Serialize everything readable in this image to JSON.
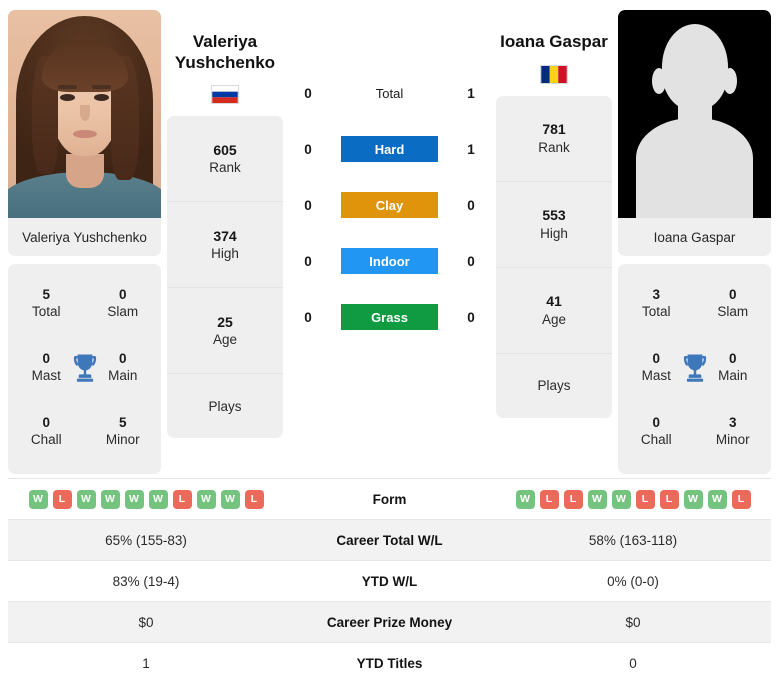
{
  "players": {
    "left": {
      "name": "Valeriya Yushchenko",
      "name_line1": "Valeriya",
      "name_line2": "Yushchenko",
      "photo_caption": "Valeriya Yushchenko",
      "country": "Russia",
      "flag_icon": "flag-russia",
      "attributes": [
        {
          "value": "605",
          "label": "Rank"
        },
        {
          "value": "374",
          "label": "High"
        },
        {
          "value": "25",
          "label": "Age"
        },
        {
          "value": "",
          "label": "Plays"
        }
      ],
      "titles": [
        {
          "value": "5",
          "label": "Total"
        },
        {
          "value": "0",
          "label": "Slam"
        },
        {
          "value": "0",
          "label": "Mast"
        },
        {
          "value": "0",
          "label": "Main"
        },
        {
          "value": "0",
          "label": "Chall"
        },
        {
          "value": "5",
          "label": "Minor"
        }
      ],
      "form": [
        "W",
        "L",
        "W",
        "W",
        "W",
        "W",
        "L",
        "W",
        "W",
        "L"
      ]
    },
    "right": {
      "name": "Ioana Gaspar",
      "name_line1": "Ioana Gaspar",
      "name_line2": "",
      "photo_caption": "Ioana Gaspar",
      "country": "Romania",
      "flag_icon": "flag-romania",
      "attributes": [
        {
          "value": "781",
          "label": "Rank"
        },
        {
          "value": "553",
          "label": "High"
        },
        {
          "value": "41",
          "label": "Age"
        },
        {
          "value": "",
          "label": "Plays"
        }
      ],
      "titles": [
        {
          "value": "3",
          "label": "Total"
        },
        {
          "value": "0",
          "label": "Slam"
        },
        {
          "value": "0",
          "label": "Mast"
        },
        {
          "value": "0",
          "label": "Main"
        },
        {
          "value": "0",
          "label": "Chall"
        },
        {
          "value": "3",
          "label": "Minor"
        }
      ],
      "form": [
        "W",
        "L",
        "L",
        "W",
        "W",
        "L",
        "L",
        "W",
        "W",
        "L"
      ]
    }
  },
  "head_to_head": [
    {
      "label": "Total",
      "left": "0",
      "right": "1",
      "color": "",
      "style": "plain"
    },
    {
      "label": "Hard",
      "left": "0",
      "right": "1",
      "color": "#0b6cc4",
      "style": "bar"
    },
    {
      "label": "Clay",
      "left": "0",
      "right": "0",
      "color": "#e0940b",
      "style": "bar"
    },
    {
      "label": "Indoor",
      "left": "0",
      "right": "0",
      "color": "#2196f3",
      "style": "bar"
    },
    {
      "label": "Grass",
      "left": "0",
      "right": "0",
      "color": "#109b43",
      "style": "bar"
    }
  ],
  "comparison_rows": [
    {
      "label": "Form",
      "left": "",
      "right": "",
      "type": "form",
      "shaded": false
    },
    {
      "label": "Career Total W/L",
      "left": "65% (155-83)",
      "right": "58% (163-118)",
      "type": "text",
      "shaded": true
    },
    {
      "label": "YTD W/L",
      "left": "83% (19-4)",
      "right": "0% (0-0)",
      "type": "text",
      "shaded": false
    },
    {
      "label": "Career Prize Money",
      "left": "$0",
      "right": "$0",
      "type": "text",
      "shaded": true
    },
    {
      "label": "YTD Titles",
      "left": "1",
      "right": "0",
      "type": "text",
      "shaded": false
    }
  ],
  "icons": {
    "trophy": "trophy-icon"
  },
  "colors": {
    "win_badge": "#74c47f",
    "loss_badge": "#ec6a5a",
    "trophy": "#3f77bb",
    "card_bg": "#efefef"
  }
}
